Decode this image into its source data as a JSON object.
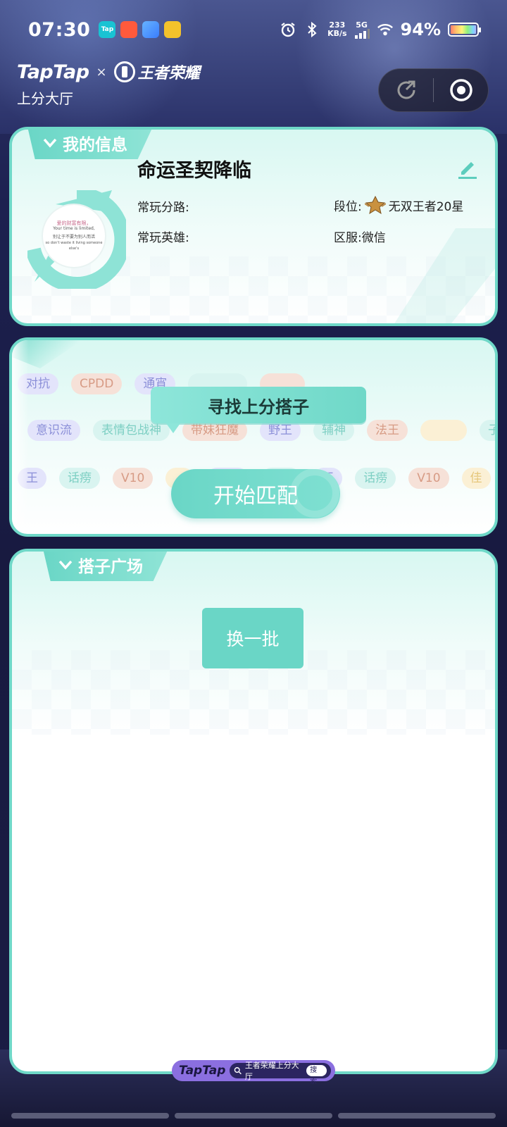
{
  "status_bar": {
    "time": "07:30",
    "net_speed_value": "233",
    "net_speed_unit": "KB/s",
    "network": "5G",
    "battery": "94%"
  },
  "header": {
    "brand_taptap": "TapTap",
    "cross": "×",
    "brand_game": "王者荣耀",
    "subtitle": "上分大厅"
  },
  "my_info": {
    "section_title": "我的信息",
    "nickname": "命运圣契降临",
    "lane_label": "常玩分路:",
    "hero_label": "常玩英雄:",
    "rank_label": "段位:",
    "rank_value": "无双王者20星",
    "server_label": "区服:微信",
    "avatar_text": [
      "爱的财富有限，",
      "Your time is limited,",
      "别让于不要为别人而活",
      "so don't waste it living someone else's"
    ]
  },
  "matching": {
    "tags_row1": [
      {
        "text": "对抗",
        "color": "purple"
      },
      {
        "text": "CPDD",
        "color": "peach"
      },
      {
        "text": "通宵",
        "color": "purple"
      },
      {
        "text": "",
        "color": "cyan"
      },
      {
        "text": "",
        "color": "peach"
      }
    ],
    "tags_row2": [
      {
        "text": "意识流",
        "color": "purple"
      },
      {
        "text": "表情包战神",
        "color": "cyan"
      },
      {
        "text": "带妹狂魔",
        "color": "peach"
      },
      {
        "text": "野王",
        "color": "purple"
      },
      {
        "text": "辅神",
        "color": "cyan"
      },
      {
        "text": "法王",
        "color": "peach"
      },
      {
        "text": "",
        "color": "yellow"
      },
      {
        "text": "子",
        "color": "cyan"
      }
    ],
    "tags_row3": [
      {
        "text": "王",
        "color": "purple"
      },
      {
        "text": "话痨",
        "color": "cyan"
      },
      {
        "text": "V10",
        "color": "peach"
      },
      {
        "text": "",
        "color": "yellow"
      },
      {
        "text": "",
        "color": "purple"
      },
      {
        "text": "",
        "color": "cyan"
      },
      {
        "text": "王",
        "color": "purple"
      },
      {
        "text": "话痨",
        "color": "cyan"
      },
      {
        "text": "V10",
        "color": "peach"
      },
      {
        "text": "佳",
        "color": "yellow"
      }
    ],
    "bubble_text": "寻找上分搭子",
    "match_button": "开始匹配"
  },
  "plaza": {
    "section_title": "搭子广场",
    "refresh_button": "换一批"
  },
  "footer_badge": {
    "logo": "TapTap",
    "search_text": "王者荣耀上分大厅",
    "search_button": "搜索"
  },
  "colors": {
    "accent": "#6ad6c6",
    "card_border": "#6fd8c8",
    "background": "#1d2150"
  }
}
